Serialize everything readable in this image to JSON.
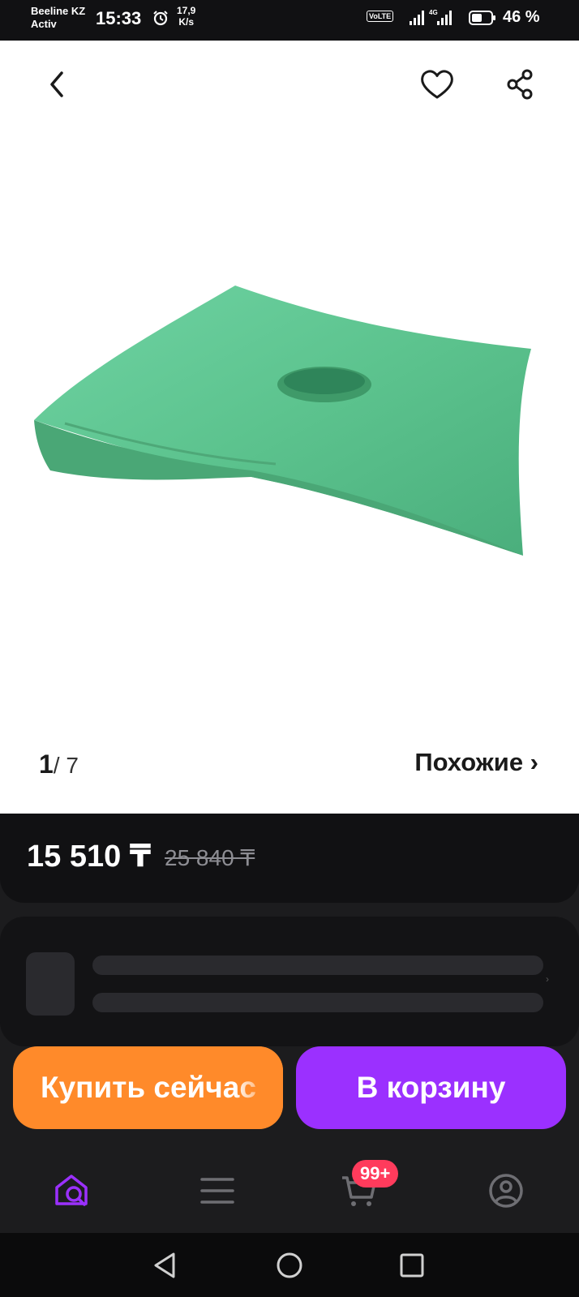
{
  "status_bar": {
    "carrier_line1": "Beeline KZ",
    "carrier_line2": "Activ",
    "time": "15:33",
    "speed_value": "17,9",
    "speed_unit": "K/s",
    "volte": "VoLTE",
    "battery": "46 %"
  },
  "product": {
    "image_counter_current": "1",
    "image_counter_total": "/ 7",
    "similar_link": "Похожие ›",
    "price": "15 510 ₸",
    "old_price": "25 840 ₸",
    "image_color": "#5fc792"
  },
  "actions": {
    "buy_now": "Купить сейчас",
    "add_to_cart": "В корзину"
  },
  "bottom_nav": {
    "cart_badge": "99+"
  },
  "colors": {
    "buy_button": "#ff8a2a",
    "cart_button": "#9b30ff",
    "badge": "#ff3b5c",
    "nav_active": "#9b30ff"
  }
}
